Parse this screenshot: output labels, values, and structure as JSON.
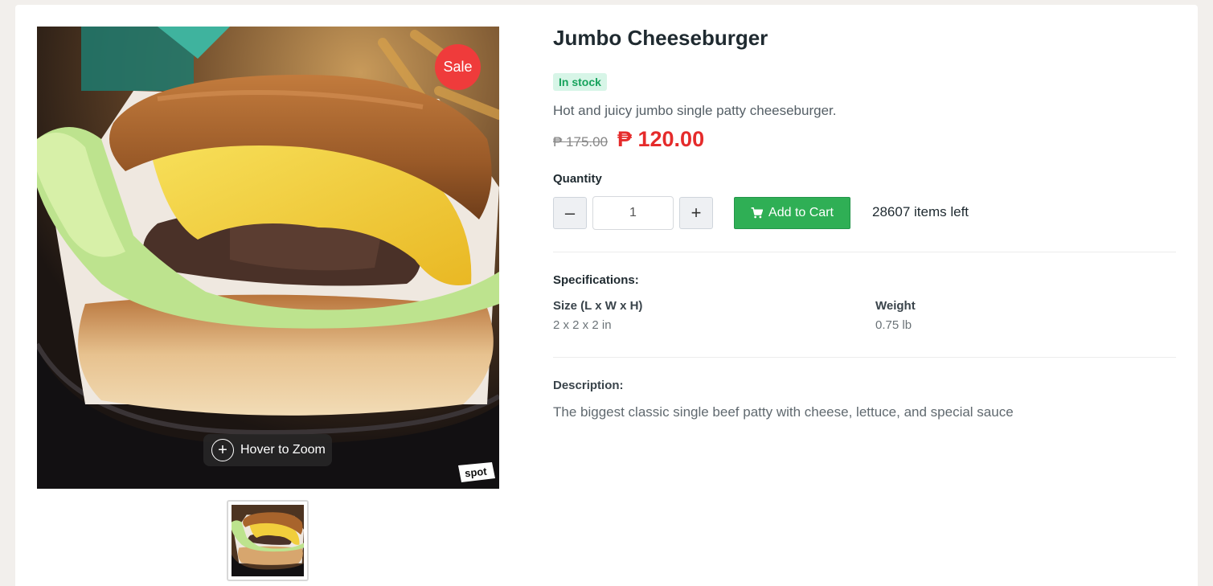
{
  "product": {
    "title": "Jumbo Cheeseburger",
    "stock_status": "In stock",
    "short_description": "Hot and juicy jumbo single patty cheeseburger.",
    "original_price": "₱ 175.00",
    "sale_price": "₱ 120.00",
    "sale_badge": "Sale",
    "zoom_hint": "Hover to Zoom",
    "image_watermark": "spot"
  },
  "quantity": {
    "label": "Quantity",
    "value": "1",
    "minus_symbol": "–",
    "plus_symbol": "+",
    "items_left": "28607 items left"
  },
  "cart": {
    "add_label": "Add to Cart",
    "icon": "cart-icon"
  },
  "specifications": {
    "title": "Specifications:",
    "items": [
      {
        "label": "Size (L x W x H)",
        "value": "2 x 2 x 2 in"
      },
      {
        "label": "Weight",
        "value": "0.75 lb"
      }
    ]
  },
  "description": {
    "title": "Description:",
    "text": "The biggest classic single beef patty with cheese, lettuce, and special sauce"
  },
  "colors": {
    "sale_red": "#e52b2b",
    "cart_green": "#2faf55",
    "stock_green": "#17a35c",
    "page_background": "#f2efec"
  }
}
